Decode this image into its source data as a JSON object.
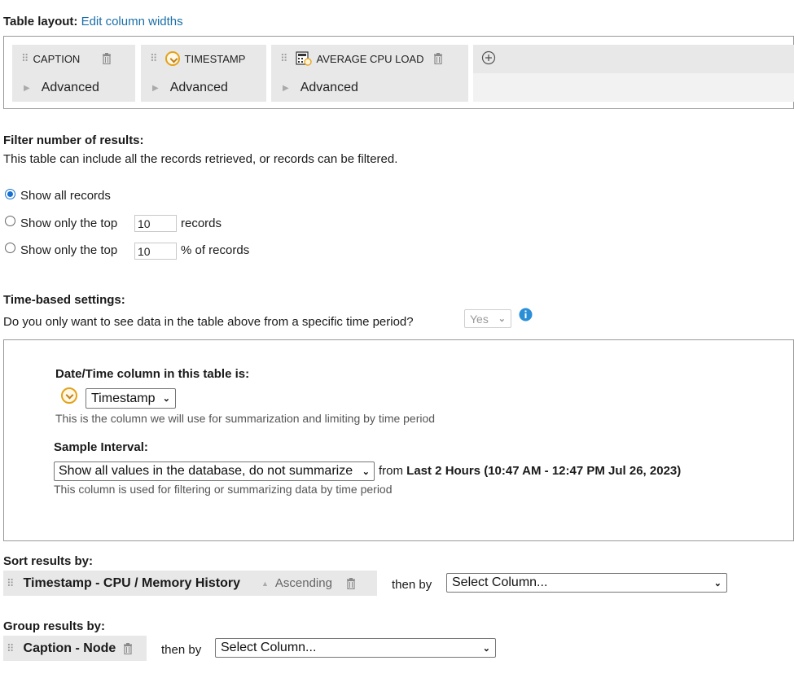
{
  "table_layout": {
    "label": "Table layout:",
    "edit_link": "Edit column widths",
    "columns": [
      {
        "name": "CAPTION",
        "advanced": "Advanced"
      },
      {
        "name": "TIMESTAMP",
        "advanced": "Advanced"
      },
      {
        "name": "AVERAGE CPU LOAD",
        "advanced": "Advanced"
      }
    ]
  },
  "filter": {
    "title": "Filter number of results:",
    "description": "This table can include all the records retrieved, or records can be filtered.",
    "options": [
      {
        "label": "Show all records",
        "selected": true
      },
      {
        "label_before": "Show only the top",
        "value": "10",
        "label_after": "records",
        "selected": false
      },
      {
        "label_before": "Show only the top",
        "value": "10",
        "label_after": "% of records",
        "selected": false
      }
    ]
  },
  "time_settings": {
    "title": "Time-based settings:",
    "question": "Do you only want to see data in the table above from a specific time period?",
    "answer": "Yes",
    "info_icon": "info-icon",
    "datetime_label": "Date/Time column in this table is:",
    "datetime_value": "Timestamp",
    "datetime_help": "This is the column we will use for summarization and limiting by time period",
    "sample_label": "Sample Interval:",
    "sample_value": "Show all values in the database, do not summarize",
    "from_label": "from",
    "range_text": "Last 2 Hours (10:47 AM - 12:47 PM Jul 26, 2023)",
    "sample_help": "This column is used for filtering or summarizing data by time period"
  },
  "sort": {
    "title": "Sort results by:",
    "field": "Timestamp - CPU / Memory History",
    "order": "Ascending",
    "then_by": "then by",
    "select_placeholder": "Select Column..."
  },
  "group": {
    "title": "Group results by:",
    "field": "Caption - Node",
    "then_by": "then by",
    "select_placeholder": "Select Column..."
  },
  "colors": {
    "link": "#1a6fa8",
    "chip_bg": "#e8e8e8",
    "radio_selected": "#1672d0",
    "info": "#2a8fd6",
    "clock": "#e3a21a"
  }
}
